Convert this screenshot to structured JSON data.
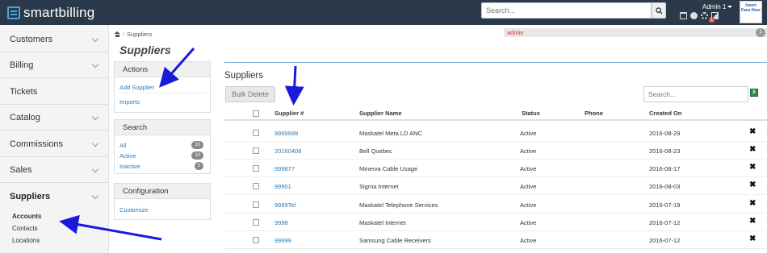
{
  "topbar": {
    "logo_text": "smartbilling",
    "search_placeholder": "Search...",
    "admin_name": "Admin 1",
    "notification_badge": "1",
    "avatar_text": "Insert Face Here"
  },
  "sidebar": {
    "items": [
      {
        "label": "Customers"
      },
      {
        "label": "Billing"
      },
      {
        "label": "Tickets"
      },
      {
        "label": "Catalog"
      },
      {
        "label": "Commissions"
      },
      {
        "label": "Sales"
      },
      {
        "label": "Suppliers"
      }
    ],
    "subitems": [
      {
        "label": "Accounts"
      },
      {
        "label": "Contacts"
      },
      {
        "label": "Locations"
      }
    ]
  },
  "breadcrumb": {
    "current": "Suppliers",
    "separator": "/"
  },
  "adminbar": {
    "label": "admin",
    "count": "1"
  },
  "page_title": "Suppliers",
  "panels": {
    "actions": {
      "title": "Actions",
      "links": [
        "Add Supplier",
        "Imports"
      ]
    },
    "search": {
      "title": "Search",
      "rows": [
        {
          "label": "All",
          "count": "10"
        },
        {
          "label": "Active",
          "count": "10"
        },
        {
          "label": "Inactive",
          "count": "0"
        }
      ]
    },
    "configuration": {
      "title": "Configuration",
      "links": [
        "Customize"
      ]
    }
  },
  "main": {
    "title": "Suppliers",
    "bulk_delete_label": "Bulk Delete",
    "search_placeholder": "Search...",
    "columns": [
      "Supplier #",
      "Supplier Name",
      "Status",
      "Phone",
      "Created On"
    ],
    "rows": [
      {
        "number": "9999999",
        "name": "Maskatel Meta LD ANC",
        "status": "Active",
        "phone": "",
        "created": "2016-08-29"
      },
      {
        "number": "20160408",
        "name": "Bell Quebec",
        "status": "Active",
        "phone": "",
        "created": "2016-08-23"
      },
      {
        "number": "999877",
        "name": "Minerva Cable Usage",
        "status": "Active",
        "phone": "",
        "created": "2016-08-17"
      },
      {
        "number": "99901",
        "name": "Sigma Internet",
        "status": "Active",
        "phone": "",
        "created": "2016-08-03"
      },
      {
        "number": "9999Tel",
        "name": "Maskatel Telephone Services",
        "status": "Active",
        "phone": "",
        "created": "2016-07-19"
      },
      {
        "number": "9998",
        "name": "Maskatel Internet",
        "status": "Active",
        "phone": "",
        "created": "2016-07-12"
      },
      {
        "number": "99999",
        "name": "Samsung Cable Receivers",
        "status": "Active",
        "phone": "",
        "created": "2016-07-12"
      }
    ]
  },
  "colors": {
    "topbar": "#2b3a4a",
    "link": "#2a7ab8",
    "annotation_arrow": "#1a1adb",
    "admin_text": "#c0392b"
  }
}
